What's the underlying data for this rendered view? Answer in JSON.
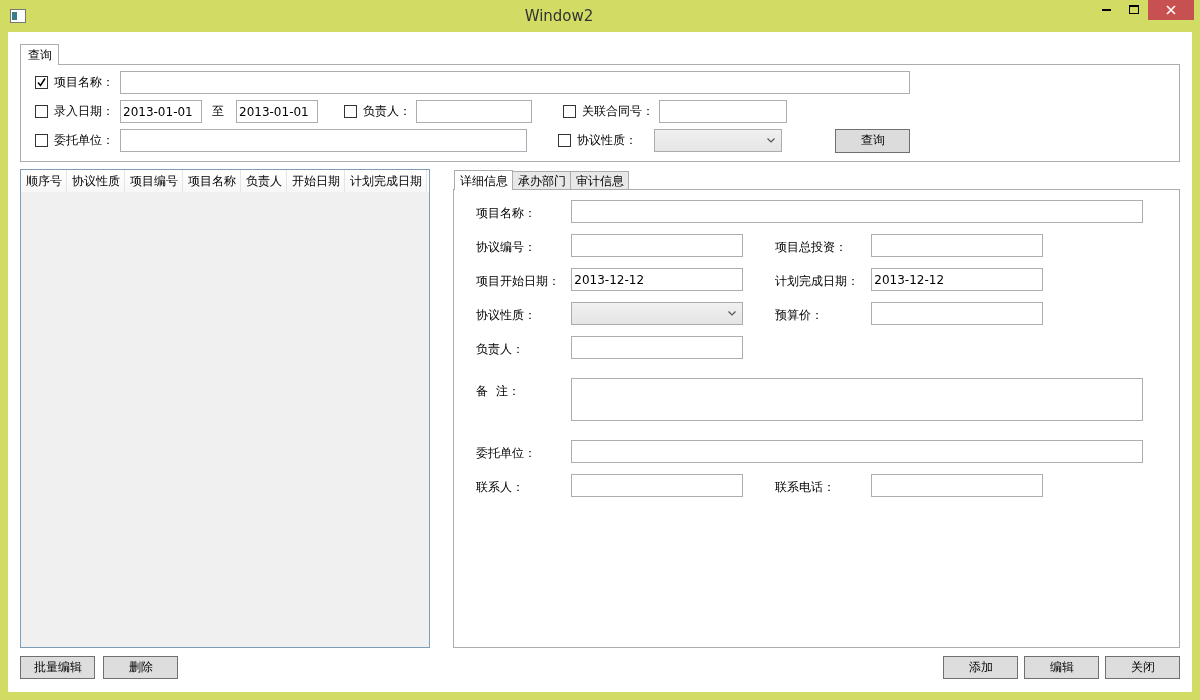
{
  "window": {
    "title": "Window2"
  },
  "query": {
    "tab": {
      "label": "查询",
      "selected": true
    },
    "rows": [
      {
        "filters": [
          {
            "kind": "text",
            "label": "项目名称：",
            "checked": true
          }
        ]
      },
      {
        "filters": [
          {
            "kind": "daterange",
            "label": "录入日期：",
            "checked": false,
            "from": "2013-01-01",
            "separator": "至",
            "to": "2013-01-01"
          },
          {
            "kind": "text",
            "label": "负责人：",
            "checked": false
          },
          {
            "kind": "text",
            "label": "关联合同号：",
            "checked": false
          }
        ]
      },
      {
        "filters": [
          {
            "kind": "text",
            "label": "委托单位：",
            "checked": false
          },
          {
            "kind": "select",
            "label": "协议性质：",
            "checked": false
          }
        ]
      }
    ],
    "button": "查询"
  },
  "table": {
    "columns": [
      "顺序号",
      "协议性质",
      "项目编号",
      "项目名称",
      "负责人",
      "开始日期",
      "计划完成日期"
    ]
  },
  "detail": {
    "tabs": [
      {
        "label": "详细信息",
        "selected": true
      },
      {
        "label": "承办部门",
        "selected": false
      },
      {
        "label": "审计信息",
        "selected": false
      }
    ],
    "rows": [
      {
        "fields": [
          {
            "kind": "wide_text",
            "label": "项目名称："
          }
        ]
      },
      {
        "fields": [
          {
            "kind": "text",
            "label": "协议编号："
          },
          {
            "kind": "text",
            "label": "项目总投资："
          }
        ]
      },
      {
        "fields": [
          {
            "kind": "text",
            "label": "项目开始日期：",
            "value": "2013-12-12"
          },
          {
            "kind": "text",
            "label": "计划完成日期：",
            "value": "2013-12-12"
          }
        ]
      },
      {
        "fields": [
          {
            "kind": "select",
            "label": "协议性质："
          },
          {
            "kind": "text",
            "label": "预算价："
          }
        ]
      },
      {
        "fields": [
          {
            "kind": "text",
            "label": "负责人："
          }
        ]
      },
      {
        "fields": [
          {
            "kind": "textarea",
            "label": "备  注："
          }
        ]
      },
      {
        "fields": [
          {
            "kind": "wide_text",
            "label": "委托单位："
          }
        ]
      },
      {
        "fields": [
          {
            "kind": "text",
            "label": "联系人："
          },
          {
            "kind": "text",
            "label": "联系电话："
          }
        ]
      }
    ]
  },
  "buttons_left": [
    "批量编辑",
    "删除"
  ],
  "buttons_right": [
    "添加",
    "编辑",
    "关闭"
  ]
}
